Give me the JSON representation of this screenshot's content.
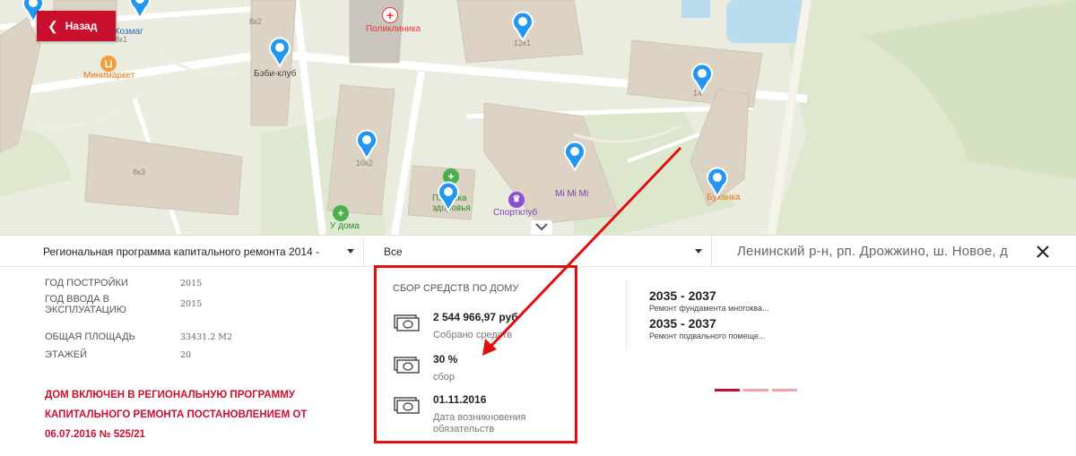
{
  "back_button": {
    "label": "Назад"
  },
  "map": {
    "pois": [
      {
        "name": "Поликлиника",
        "icon": "hospital-icon"
      },
      {
        "name": "Минимаркет",
        "icon": "basket-icon"
      },
      {
        "name": "Бэби-клуб",
        "icon": "map-pin-icon"
      },
      {
        "name": "У дома",
        "icon": "pharmacy-icon"
      },
      {
        "name": "Пятёрка здоровья",
        "icon": "pharmacy-icon"
      },
      {
        "name": "Спортклуб",
        "icon": "trophy-icon"
      },
      {
        "name": "Mi Mi Mi",
        "icon": "scissors-icon"
      },
      {
        "name": "Буханка",
        "icon": "fork-knife-icon"
      },
      {
        "name": "Хозмаг",
        "icon": "shop-icon"
      }
    ],
    "house_numbers": [
      "8к1",
      "8к2",
      "8к3",
      "10к2",
      "12к1",
      "14"
    ]
  },
  "filters": {
    "program": "Региональная программа капитального ремонта 2014 -",
    "type": "Все",
    "address": "Ленинский р-н, рп. Дрожжино, ш. Новое, д"
  },
  "house_info": {
    "rows": [
      {
        "label": "ГОД ПОСТРОЙКИ",
        "value": "2015"
      },
      {
        "label": "ГОД ВВОДА В ЭКСПЛУАТАЦИЮ",
        "value": "2015"
      },
      {
        "label": "ОБЩАЯ ПЛОЩАДЬ",
        "value": "33431.2 М2"
      },
      {
        "label": "ЭТАЖЕЙ",
        "value": "20"
      }
    ],
    "notice": "ДОМ ВКЛЮЧЕН В РЕГИОНАЛЬНУЮ ПРОГРАММУ КАПИТАЛЬНОГО РЕМОНТА ПОСТАНОВЛЕНИЕМ ОТ 06.07.2016 № 525/21"
  },
  "funds": {
    "title": "СБОР СРЕДСТВ ПО ДОМУ",
    "items": [
      {
        "value": "2 544 966,97 руб",
        "caption": "Собрано средств"
      },
      {
        "value": "30 %",
        "caption": "сбор"
      },
      {
        "value": "01.11.2016",
        "caption": "Дата возникновения обязательств"
      }
    ]
  },
  "works": [
    {
      "years": "2035 - 2037",
      "name": "Ремонт фундамента многоква..."
    },
    {
      "years": "2035 - 2037",
      "name": "Ремонт подвального помеще..."
    }
  ],
  "pager": {
    "count": 3,
    "active": 0
  },
  "colors": {
    "brand_red": "#c8102e",
    "highlight_red": "#e01010",
    "pin_blue": "#2196f3"
  }
}
